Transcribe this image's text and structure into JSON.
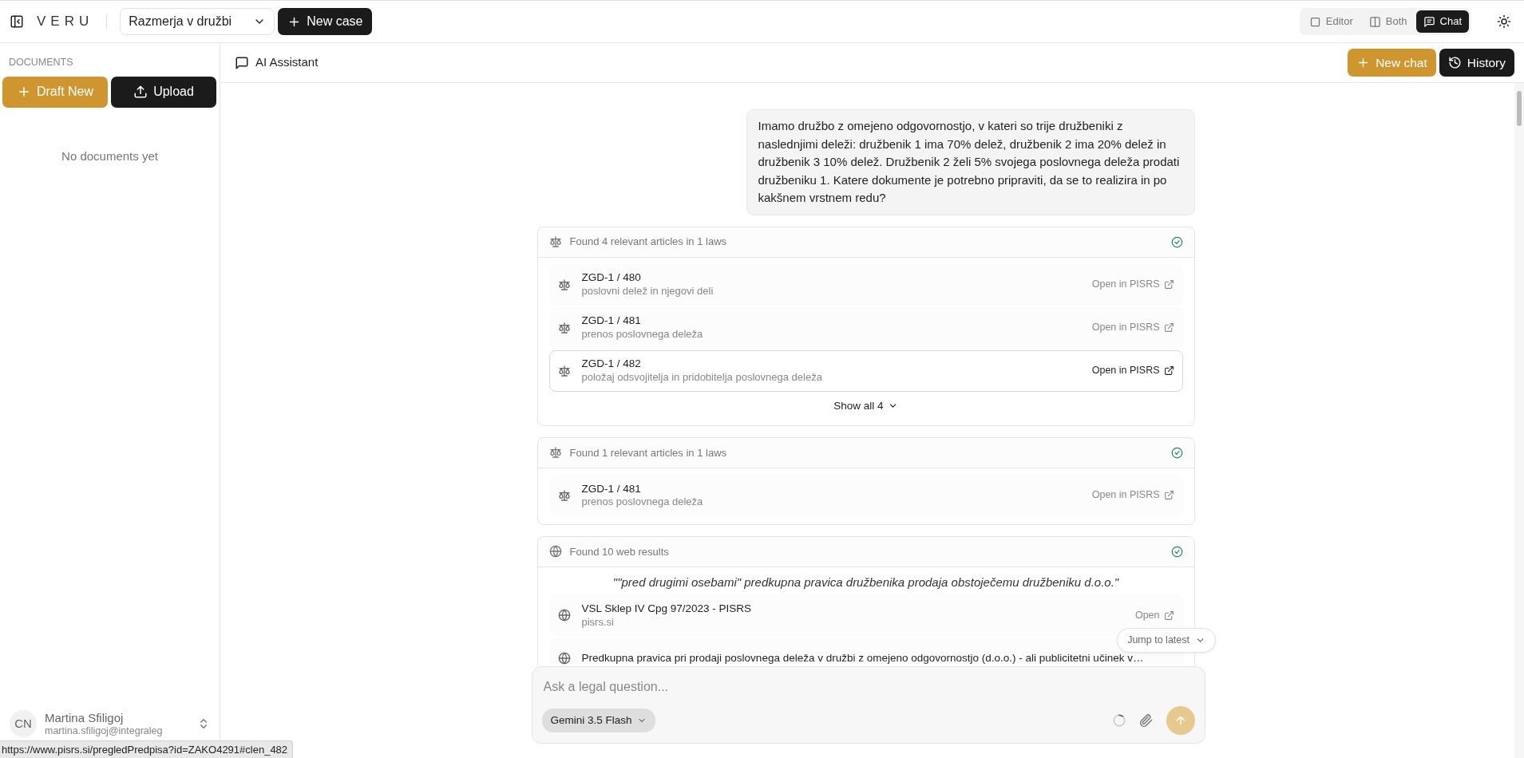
{
  "app": {
    "logo": "VERU",
    "case_select": "Razmerja v družbi",
    "new_case": "New case"
  },
  "view_modes": [
    {
      "label": "Editor",
      "kind": "editor",
      "selected": false
    },
    {
      "label": "Both",
      "kind": "both",
      "selected": false
    },
    {
      "label": "Chat",
      "kind": "chat",
      "selected": true
    }
  ],
  "sidebar": {
    "heading": "DOCUMENTS",
    "buttons": [
      {
        "label": "Draft New",
        "kind": "primary"
      },
      {
        "label": "Upload",
        "kind": "dark"
      }
    ],
    "empty": "No documents yet",
    "user": {
      "initials": "CN",
      "name": "Martina Sfiligoj",
      "email": "martina.sfiligoj@integraleg"
    }
  },
  "chat_header": {
    "title": "AI Assistant",
    "buttons": [
      {
        "label": "New chat",
        "kind": "primary"
      },
      {
        "label": "History",
        "kind": "dark"
      }
    ]
  },
  "messages": [
    {
      "kind": "user",
      "text": "Imamo družbo z omejeno odgovornostjo, v kateri so trije družbeniki z naslednjimi deleži: družbenik 1 ima 70% delež, družbenik 2 ima 20% delež in družbenik 3 10% delež. Družbenik 2 želi 5% svojega poslovnega deleža prodati družbeniku 1. Katere dokumente je potrebno pripraviti, da se to realizira in po kakšnem vrstnem redu?"
    },
    {
      "kind": "laws",
      "header": "Found 4 relevant articles in 1 laws",
      "done": true,
      "items": [
        {
          "title": "ZGD-1 / 480",
          "subtitle": "poslovni delež in njegovi deli",
          "link": "Open in PISRS",
          "highlighted": false
        },
        {
          "title": "ZGD-1 / 481",
          "subtitle": "prenos poslovnega deleža",
          "link": "Open in PISRS",
          "highlighted": false
        },
        {
          "title": "ZGD-1 / 482",
          "subtitle": "položaj odsvojitelja in pridobitelja poslovnega deleža",
          "link": "Open in PISRS",
          "highlighted": true
        }
      ],
      "footer": "Show all 4"
    },
    {
      "kind": "laws",
      "header": "Found 1 relevant articles in 1 laws",
      "done": true,
      "items": [
        {
          "title": "ZGD-1 / 481",
          "subtitle": "prenos poslovnega deleža",
          "link": "Open in PISRS",
          "highlighted": false
        }
      ]
    },
    {
      "kind": "web",
      "header": "Found 10 web results",
      "done": true,
      "query": "\"\"pred drugimi osebami\" predkupna pravica družbenika prodaja obstoječemu družbeniku d.o.o.\"",
      "items": [
        {
          "title": "VSL Sklep IV Cpg 97/2023 - PISRS",
          "subtitle": "pisrs.si",
          "link": "Open",
          "highlighted": false
        },
        {
          "title": "Predkupna pravica pri prodaji poslovnega deleža v družbi z omejeno odgovornostjo (d.o.o.) - ali publicitetni učinek v…",
          "highlighted": false
        }
      ]
    }
  ],
  "jump_button": "Jump to latest",
  "composer": {
    "placeholder": "Ask a legal question...",
    "model": "Gemini 3.5 Flash",
    "send_disabled": true
  },
  "status_url": "https://www.pisrs.si/pregledPredpisa?id=ZAKO4291#clen_482"
}
